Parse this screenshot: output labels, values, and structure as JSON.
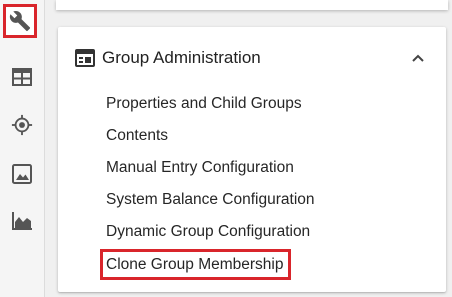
{
  "rail": {
    "items": [
      {
        "icon": "wrench-icon",
        "active": true
      },
      {
        "icon": "table-icon",
        "active": false
      },
      {
        "icon": "target-icon",
        "active": false
      },
      {
        "icon": "image-icon",
        "active": false
      },
      {
        "icon": "area-chart-icon",
        "active": false
      }
    ]
  },
  "panel": {
    "title": "Group Administration",
    "items": [
      {
        "label": "Properties and Child Groups"
      },
      {
        "label": "Contents"
      },
      {
        "label": "Manual Entry Configuration"
      },
      {
        "label": "System Balance Configuration"
      },
      {
        "label": "Dynamic Group Configuration"
      },
      {
        "label": "Clone Group Membership"
      }
    ]
  },
  "colors": {
    "highlight": "#d9252b",
    "icon": "#555555",
    "text": "#222222"
  }
}
